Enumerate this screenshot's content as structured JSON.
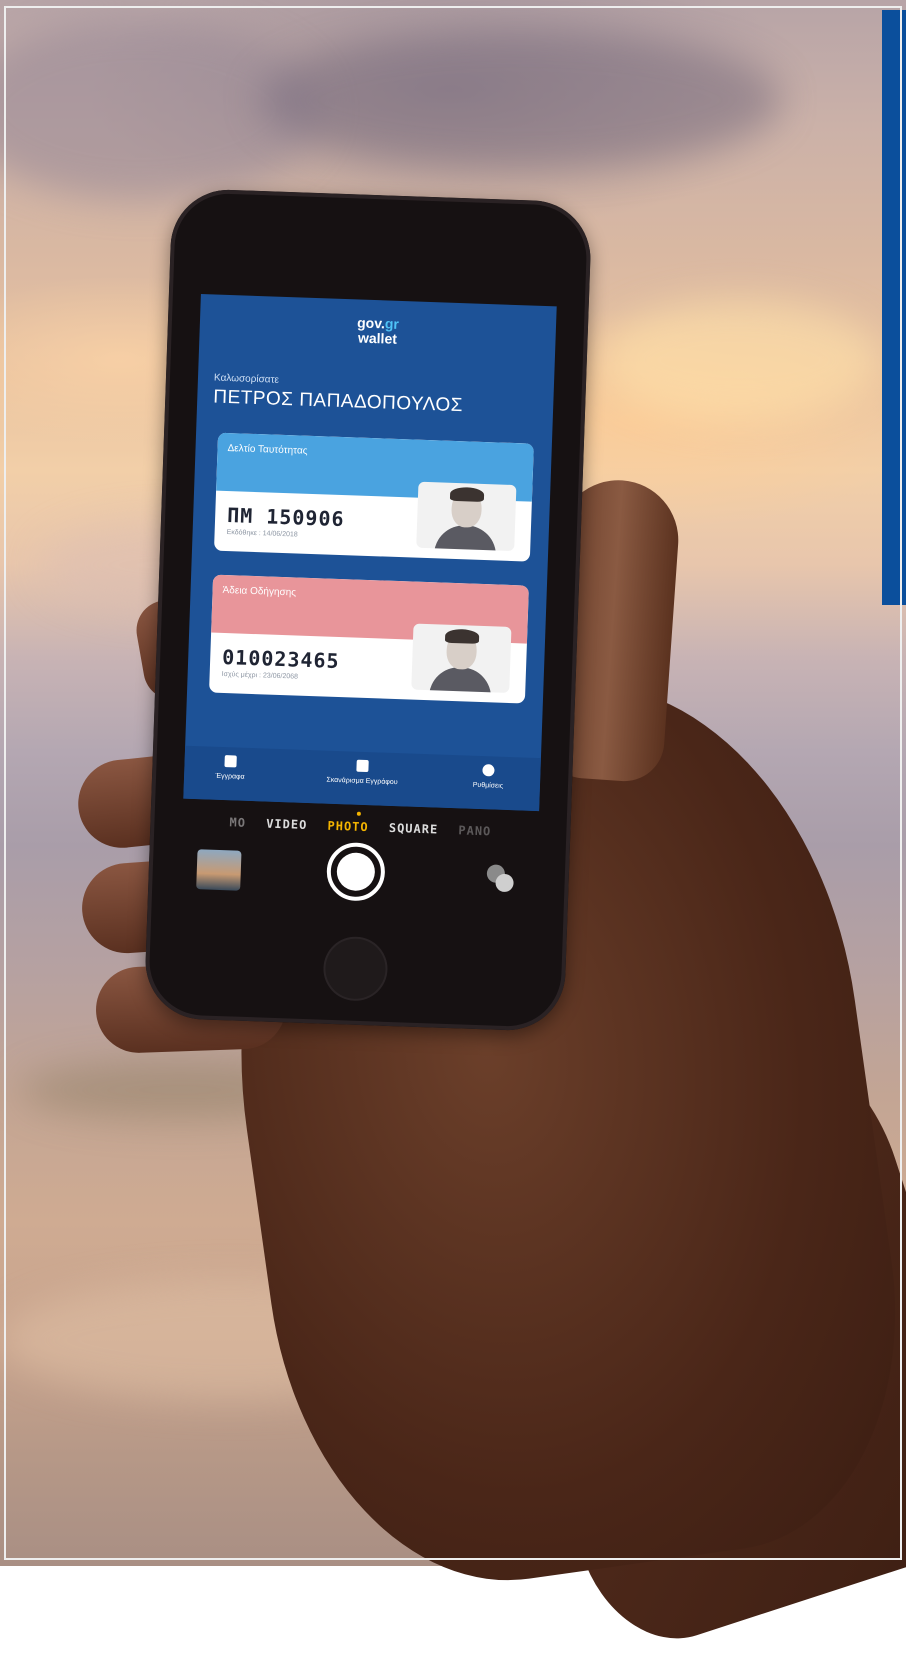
{
  "wallet_app": {
    "logo_line1": "gov.",
    "logo_gr": "gr",
    "logo_line2": "wallet",
    "greeting": "Καλωσορίσατε",
    "user_name": "ΠΕΤΡΟΣ ΠΑΠΑΔΟΠΟΥΛΟΣ",
    "cards": [
      {
        "title": "Δελτίο Ταυτότητας",
        "number": "ΠΜ 150906",
        "subtitle": "Εκδόθηκε : 14/06/2018",
        "color": "#4aa3e0"
      },
      {
        "title": "Άδεια Οδήγησης",
        "number": "010023465",
        "subtitle": "Ισχύς μέχρι : 23/06/2068",
        "color": "#e8959a"
      }
    ],
    "tabs": [
      {
        "label": "Έγγραφα",
        "icon": "document-icon"
      },
      {
        "label": "Σκανάρισμα Εγγράφου",
        "icon": "grid-icon"
      },
      {
        "label": "Ρυθμίσεις",
        "icon": "gear-icon"
      }
    ]
  },
  "camera": {
    "modes": [
      "MO",
      "VIDEO",
      "PHOTO",
      "SQUARE",
      "PANO"
    ],
    "active_mode": "PHOTO",
    "accent_color": "#f4b400"
  },
  "colors": {
    "app_blue": "#1d5297",
    "side_bar_blue": "#0b4f9c"
  }
}
